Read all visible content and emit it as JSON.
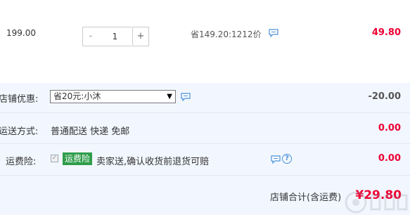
{
  "product_row": {
    "unit_price": "199.00",
    "quantity": {
      "minus_label": "-",
      "value": "1",
      "plus_label": "+"
    },
    "saving_text": "省149.20:1212价",
    "subtotal": "49.80"
  },
  "shop_discount": {
    "label": "店铺优惠:",
    "selected_option": "省20元:小沐",
    "amount": "-20.00"
  },
  "shipping": {
    "label": "运送方式:",
    "value": "普通配送 快递 免邮",
    "amount": "0.00"
  },
  "shipping_insurance": {
    "label": "运费险:",
    "checked": true,
    "badge": "运费险",
    "description": "卖家送,确认收货前退货可赔",
    "amount": "0.00"
  },
  "total": {
    "label": "店铺合计(含运费)",
    "amount": "¥29.80"
  },
  "colors": {
    "price_red": "#ee0033",
    "panel_bg": "#f2f7ff",
    "badge_green": "#2f9d4a",
    "icon_blue": "#4a90d9"
  },
  "icons": [
    "chat-bubble-icon",
    "dropdown-arrow-icon",
    "checkbox-icon",
    "help-icon"
  ]
}
